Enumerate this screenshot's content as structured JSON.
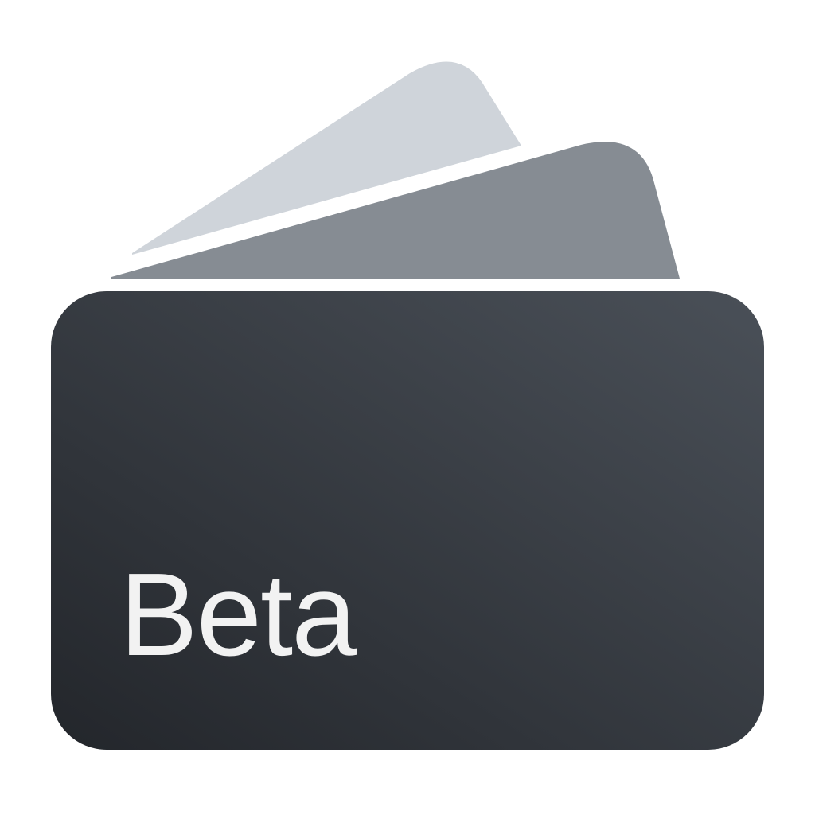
{
  "app_icon": {
    "badge": {
      "label": "Beta"
    },
    "colors": {
      "background": "#ffffff",
      "back_card": "#cfd4da",
      "middle_card": "#868c93",
      "body_gradient_top_right": "#4a5058",
      "body_gradient_bottom_left": "#23262b",
      "label_text": "#f2f2f2"
    },
    "icons": [
      "back-card-icon",
      "middle-card-icon",
      "wallet-body-icon"
    ]
  }
}
